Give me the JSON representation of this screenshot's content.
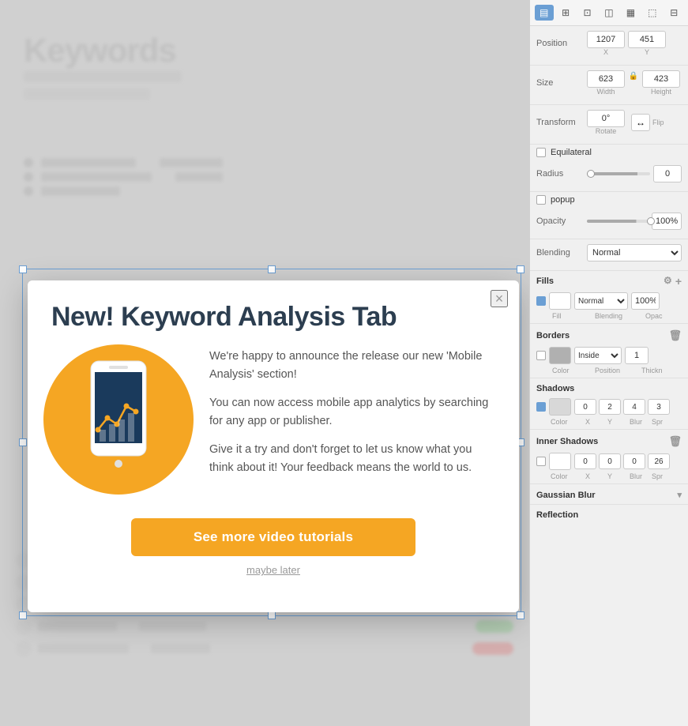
{
  "canvas": {
    "background_color": "#d4d4d4"
  },
  "popup": {
    "title": "New! Keyword Analysis Tab",
    "close_label": "×",
    "paragraph1": "We're happy to announce the release our new 'Mobile Analysis' section!",
    "paragraph2": "You can now access mobile app analytics by searching for any app or publisher.",
    "paragraph3": "Give it a try and don't forget to let us know what you think about it! Your feedback means the world to us.",
    "cta_label": "See more video tutorials",
    "maybe_later_label": "maybe later"
  },
  "right_panel": {
    "position_label": "Position",
    "position_x_value": "1207",
    "position_y_value": "451",
    "position_x_sub": "X",
    "position_y_sub": "Y",
    "size_label": "Size",
    "size_width_value": "623",
    "size_height_value": "423",
    "size_width_sub": "Width",
    "size_height_sub": "Height",
    "transform_label": "Transform",
    "transform_rotate_value": "0°",
    "transform_rotate_sub": "Rotate",
    "transform_flip_sub": "Flip",
    "equilateral_label": "Equilateral",
    "radius_label": "Radius",
    "radius_value": "0",
    "popup_label": "popup",
    "opacity_label": "Opacity",
    "opacity_value": "100%",
    "blending_label": "Blending",
    "blending_value": "Normal",
    "fills_label": "Fills",
    "fills_blending_value": "Normal",
    "fills_opacity_value": "100%",
    "fills_col_fill": "Fill",
    "fills_col_blending": "Blending",
    "fills_col_opacity": "Opac",
    "borders_label": "Borders",
    "borders_position_value": "Inside",
    "borders_thickness_value": "1",
    "borders_col_color": "Color",
    "borders_col_position": "Position",
    "borders_col_thickness": "Thickn",
    "shadows_label": "Shadows",
    "shadows_x": "0",
    "shadows_y": "2",
    "shadows_blur": "4",
    "shadows_spread": "3",
    "shadows_col_color": "Color",
    "shadows_col_x": "X",
    "shadows_col_y": "Y",
    "shadows_col_blur": "Blur",
    "shadows_col_spread": "Spr",
    "inner_shadows_label": "Inner Shadows",
    "inner_shadows_x": "0",
    "inner_shadows_y": "0",
    "inner_shadows_blur": "0",
    "inner_shadows_spread": "26",
    "inner_shadows_col_color": "Color",
    "inner_shadows_col_x": "X",
    "inner_shadows_col_y": "Y",
    "inner_shadows_col_blur": "Blur",
    "inner_shadows_col_spread": "Spr",
    "gaussian_blur_label": "Gaussian Blur",
    "reflection_label": "Reflection"
  }
}
